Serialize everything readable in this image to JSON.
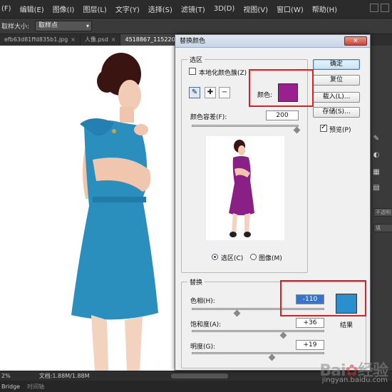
{
  "menu": {
    "items": [
      "(F)",
      "编辑(E)",
      "图像(I)",
      "图层(L)",
      "文字(Y)",
      "选择(S)",
      "滤镜(T)",
      "3D(D)",
      "视图(V)",
      "窗口(W)",
      "帮助(H)"
    ]
  },
  "options_bar": {
    "sample_size_label": "取样大小:",
    "sample_size_value": "取样点"
  },
  "doc_tabs": [
    {
      "label": "efb63d81ffd835b1.jpg",
      "close": "×"
    },
    {
      "label": "人像.psd",
      "close": "×"
    },
    {
      "label": "4518867_115220",
      "close": ""
    }
  ],
  "status": {
    "zoom": "2%",
    "doc_info": "文档:1.88M/1.88M"
  },
  "bottom": {
    "bridge": "Bridge",
    "timeline": "时间轴"
  },
  "right_panel": {
    "strip1": "不透明",
    "strip2": "填"
  },
  "dialog": {
    "title": "替换颜色",
    "close_symbol": "✕",
    "selection_group": "选区",
    "localized_clusters_label": "本地化颜色簇(Z)",
    "localized_clusters_checked": false,
    "color_label": "颜色:",
    "selected_color": "#9a2090",
    "fuzziness_label": "颜色容差(F):",
    "fuzziness_value": "200",
    "fuzziness_fraction": 1.0,
    "radio_selection": "选区(C)",
    "radio_image": "图像(M)",
    "replacement_group": "替换",
    "hue_label": "色相(H):",
    "hue_value": "-110",
    "hue_fraction": 0.33,
    "saturation_label": "饱和度(A):",
    "saturation_value": "+36",
    "saturation_fraction": 0.68,
    "lightness_label": "明度(G):",
    "lightness_value": "+19",
    "lightness_fraction": 0.6,
    "result_label": "结果",
    "result_color": "#2a8fcc",
    "ok_button": "确定",
    "reset_button": "复位",
    "load_button": "载入(L)...",
    "save_button": "存储(S)...",
    "preview_label": "预览(P)",
    "preview_checked": true,
    "tool_eyedropper": "eyedropper",
    "tool_add": "eyedropper-plus",
    "tool_subtract": "eyedropper-minus"
  },
  "watermark": {
    "brand": "Baidu 经验",
    "url": "jingyan.baidu.com"
  },
  "colors": {
    "dress_original": "#2a8fbd",
    "dress_preview": "#8a1f85",
    "highlight_red": "#e02020"
  }
}
